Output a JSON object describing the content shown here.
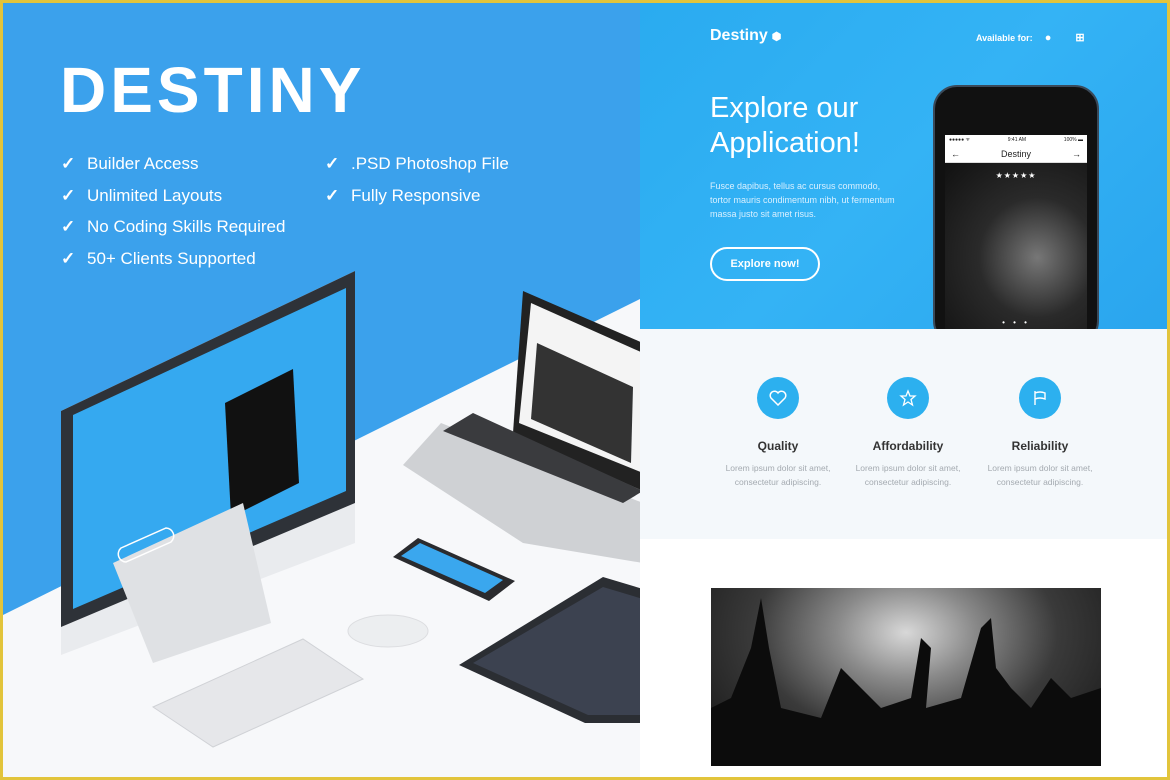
{
  "left": {
    "brand": "DESTINY",
    "features_col1": [
      "Builder Access",
      "Unlimited Layouts",
      "No Coding Skills Required",
      "50+ Clients Supported"
    ],
    "features_col2": [
      ".PSD Photoshop File",
      "Fully Responsive"
    ],
    "check_icon": "check-icon"
  },
  "hero": {
    "logo": "Destiny",
    "available": "Available for:",
    "platform_icons": [
      "android-icon",
      "apple-icon",
      "windows-icon"
    ],
    "title_line1": "Explore our",
    "title_line2": "Application!",
    "description": "Fusce dapibus, tellus ac cursus commodo, tortor mauris condimentum nibh, ut fermentum massa justo sit amet risus.",
    "button": "Explore now!",
    "phone": {
      "carrier": "●●●●● ᯤ",
      "time": "9:41 AM",
      "battery": "100% ▬",
      "title": "Destiny",
      "stars": "★★★★★",
      "dots": "• • •"
    }
  },
  "features": [
    {
      "icon": "heart-icon",
      "title": "Quality",
      "desc": "Lorem ipsum dolor sit amet, consectetur adipiscing."
    },
    {
      "icon": "star-icon",
      "title": "Affordability",
      "desc": "Lorem ipsum dolor sit amet, consectetur adipiscing."
    },
    {
      "icon": "flag-icon",
      "title": "Reliability",
      "desc": "Lorem ipsum dolor sit amet, consectetur adipiscing."
    }
  ],
  "colors": {
    "frame": "#e2c43b",
    "left_blue": "#3ba1ec",
    "hero_blue": "#2aabf0",
    "accent": "#2cb0ef"
  }
}
